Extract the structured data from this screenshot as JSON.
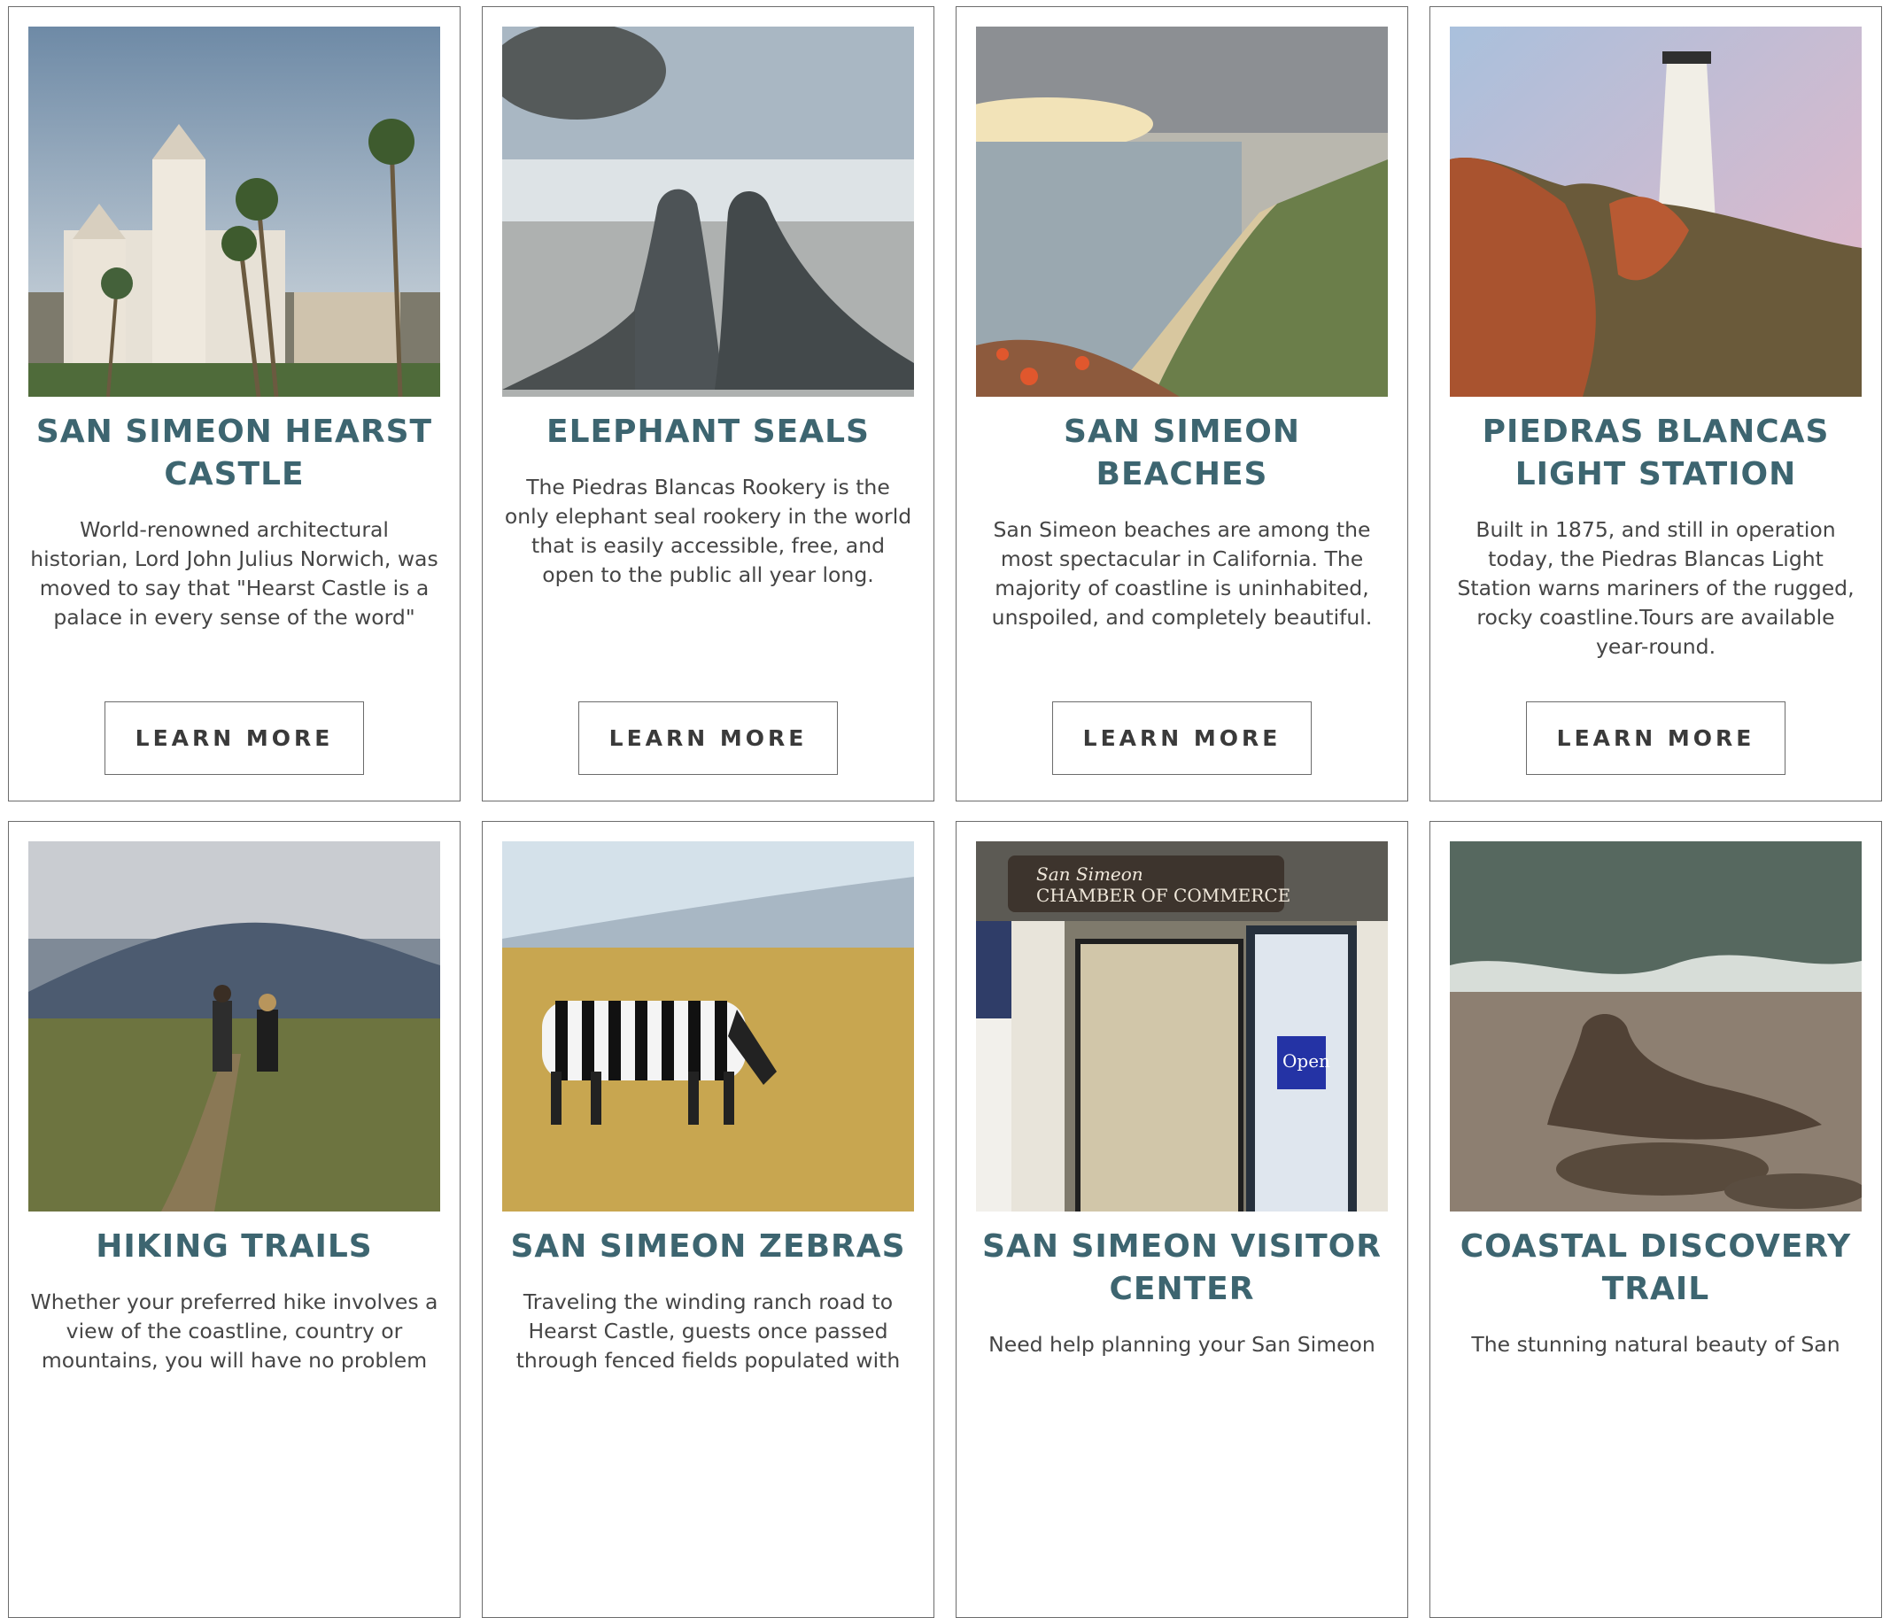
{
  "cards": [
    {
      "title": "San Simeon Hearst Castle",
      "description": "World-renowned architectural historian, Lord John Julius Norwich, was moved to say that \"Hearst Castle is a palace in every sense of the word\"",
      "button": "Learn More",
      "image": "hearst-castle-photo"
    },
    {
      "title": "Elephant Seals",
      "description": "The Piedras Blancas Rookery is the only elephant seal rookery in the world that is easily accessible, free, and open to the public all year long.",
      "button": "Learn More",
      "image": "elephant-seals-photo"
    },
    {
      "title": "San Simeon Beaches",
      "description": "San Simeon beaches are among the most spectacular in California. The majority of coastline is uninhabited, unspoiled, and completely beautiful.",
      "button": "Learn More",
      "image": "beaches-photo"
    },
    {
      "title": "Piedras Blancas Light Station",
      "description": "Built in 1875, and still in operation today, the Piedras Blancas Light Station warns mariners of the rugged, rocky coastline.Tours are available year-round.",
      "button": "Learn More",
      "image": "lighthouse-photo"
    },
    {
      "title": "Hiking Trails",
      "description": "Whether your preferred hike involves a view of the coastline, country or mountains, you will have no problem",
      "image": "hiking-trails-photo"
    },
    {
      "title": "San Simeon Zebras",
      "description": "Traveling the winding ranch road to Hearst Castle, guests once passed through fenced fields populated with",
      "image": "zebra-photo"
    },
    {
      "title": "San Simeon Visitor Center",
      "description": "Need help planning your San Simeon",
      "image": "visitor-center-photo",
      "sign_line1": "San Simeon",
      "sign_line2": "CHAMBER OF COMMERCE",
      "door_sign": "Open"
    },
    {
      "title": "Coastal Discovery Trail",
      "description": "The stunning natural beauty of San",
      "image": "coastal-trail-photo"
    }
  ]
}
